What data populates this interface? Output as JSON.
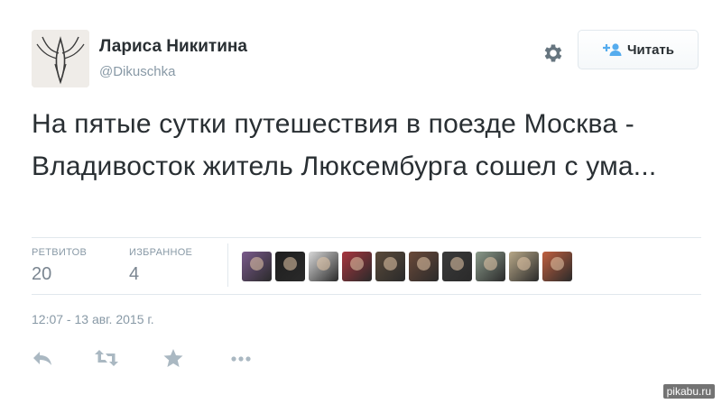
{
  "author": {
    "name": "Лариса Никитина",
    "handle": "@Dikuschka"
  },
  "follow_button": {
    "label": "Читать",
    "icon": "add-user-icon"
  },
  "tweet": {
    "text": "На пятые сутки путешествия в поезде Москва - Владивосток житель Люксембурга сошел с ума..."
  },
  "stats": {
    "retweets_label": "РЕТВИТОВ",
    "retweets_value": "20",
    "favorites_label": "ИЗБРАННОЕ",
    "favorites_value": "4"
  },
  "favoriters": [
    {
      "name": "favoriter-1",
      "color": "#7a5a8c"
    },
    {
      "name": "favoriter-2",
      "color": "#1e1e1e"
    },
    {
      "name": "favoriter-3",
      "color": "#d8d8d8"
    },
    {
      "name": "favoriter-4",
      "color": "#a8363f"
    },
    {
      "name": "favoriter-5",
      "color": "#5a4a3a"
    },
    {
      "name": "favoriter-6",
      "color": "#6b4a3a"
    },
    {
      "name": "favoriter-7",
      "color": "#3a3a3a"
    },
    {
      "name": "favoriter-8",
      "color": "#8a9a8a"
    },
    {
      "name": "favoriter-9",
      "color": "#b8a888"
    },
    {
      "name": "favoriter-10",
      "color": "#c06040"
    }
  ],
  "timestamp": "12:07 - 13 авг. 2015 г.",
  "actions": [
    "reply-icon",
    "retweet-icon",
    "favorite-icon",
    "more-icon"
  ],
  "watermark": "pikabu.ru",
  "colors": {
    "text": "#292f33",
    "muted": "#8899a6",
    "follow_icon": "#55acee",
    "divider": "#e1e8ed"
  }
}
